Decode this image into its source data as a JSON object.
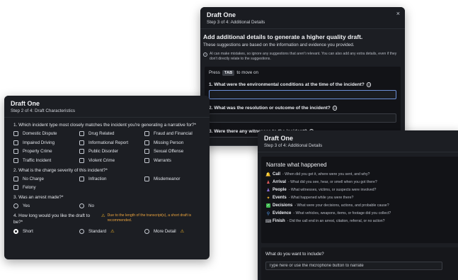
{
  "window_a": {
    "title": "Draft One",
    "step": "Step 3 of 4: Additional Details",
    "close": "×",
    "heading": "Add additional details to generate a higher quality draft.",
    "subheading": "These suggestions are based on the information and evidence you provided.",
    "notice": "AI can make mistakes, so ignore any suggestions that aren't relevant. You can also add any extra details, even if they don't directly relate to the suggestions.",
    "hint_press": "Press",
    "hint_key": "TAB",
    "hint_rest": "to move on",
    "questions": [
      "1. What were the environmental conditions at the time of the incident?",
      "2. What was the resolution or outcome of the incident?",
      "3. Were there any witnesses to the incident?"
    ]
  },
  "window_b": {
    "title": "Draft One",
    "step": "Step 2 of 4: Draft Characteristics",
    "q1": "1. Which incident type most closely matches the incident you're generating a narrative for?*",
    "incident_types": [
      "Domestic Dispute",
      "Drug Related",
      "Fraud and Financial",
      "Impaired Driving",
      "Informational Report",
      "Missing Person",
      "Property Crime",
      "Public Disorder",
      "Sexual Offense",
      "Traffic Incident",
      "Violent Crime",
      "Warrants"
    ],
    "q2": "2. What is the charge severity of this incident?*",
    "severities": [
      "No Charge",
      "Infraction",
      "Misdemeanor",
      "Felony"
    ],
    "q3": "3. Was an arrest made?*",
    "arrest_options": [
      "Yes",
      "No"
    ],
    "q4": "4. How long would you like the draft to be?*",
    "length_warning": "Due to the length of the transcript(s), a short draft is recommended.",
    "length_options": [
      "Short",
      "Standard",
      "More Detail"
    ],
    "selected_length": "Short"
  },
  "window_c": {
    "title": "Draft One",
    "step": "Step 3 of 4: Additional Details",
    "close": "×",
    "heading": "Narrate what happened",
    "items": [
      {
        "label": "Call",
        "desc": "- When did you get it, where were you sent, and why?",
        "icon": "bell-icon",
        "color": "#f0b429"
      },
      {
        "label": "Arrival",
        "desc": "- What did you see, hear, or smell when you got there?",
        "icon": "person-icon",
        "color": "#e05b5b"
      },
      {
        "label": "People",
        "desc": "- What witnesses, victims, or suspects were involved?",
        "icon": "people-icon",
        "color": "#8b6fd6"
      },
      {
        "label": "Events",
        "desc": "- What happened while you were there?",
        "icon": "sparkle-icon",
        "color": "#f0b429"
      },
      {
        "label": "Decisions",
        "desc": "- What were your decisions, actions, and probable cause?",
        "icon": "check-icon",
        "color": "#3fb950"
      },
      {
        "label": "Evidence",
        "desc": "- What vehicles, weapons, items, or footage did you collect?",
        "icon": "magnifier-icon",
        "color": "#58a6ff"
      },
      {
        "label": "Finish",
        "desc": "- Did the call end in an arrest, citation, referral, or no action?",
        "icon": "keyboard-icon",
        "color": "#c9ccd3"
      }
    ],
    "include_label": "What do you want to include?",
    "narrate_placeholder": "Type here or use the microphone button to narrate"
  }
}
